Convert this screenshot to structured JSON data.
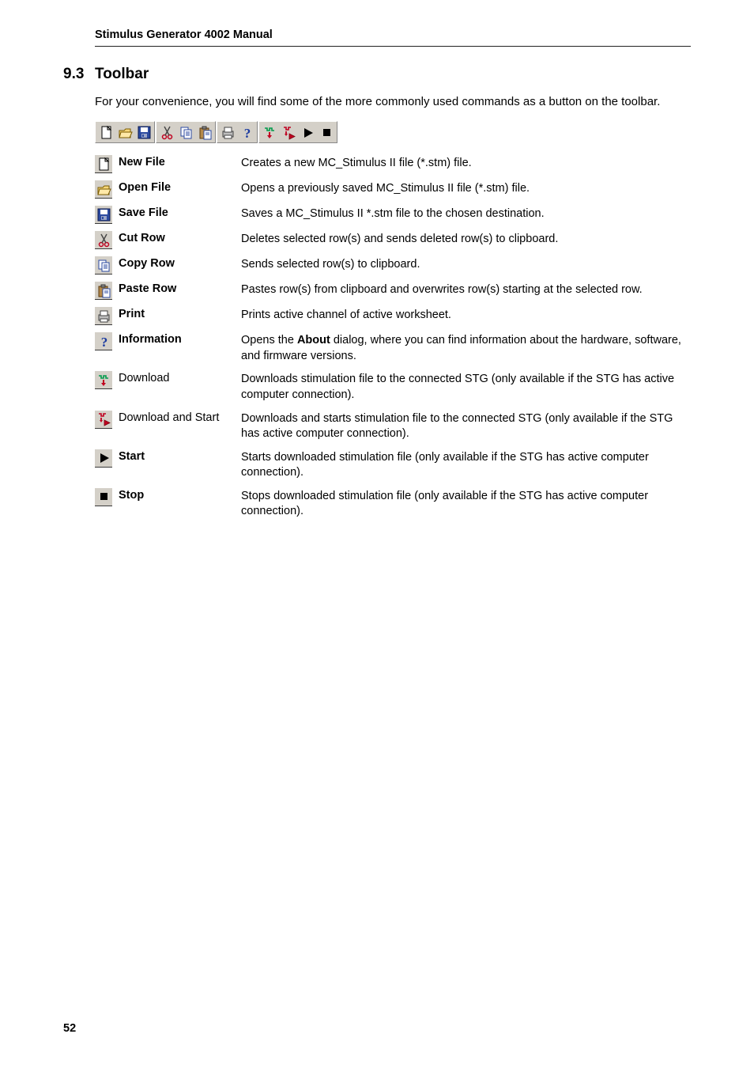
{
  "running_head": "Stimulus Generator 4002 Manual",
  "section": {
    "number": "9.3",
    "title": "Toolbar"
  },
  "intro": "For your convenience, you will find some of the more commonly used commands as a button on the toolbar.",
  "toolbar_groups": [
    [
      "new-file-icon",
      "open-file-icon",
      "save-file-icon"
    ],
    [
      "cut-icon",
      "copy-icon",
      "paste-icon"
    ],
    [
      "print-icon",
      "info-icon"
    ],
    [
      "download-icon",
      "download-start-icon",
      "play-icon",
      "stop-icon"
    ]
  ],
  "rows": [
    {
      "icon": "new-file-icon",
      "term": "New File",
      "bold": true,
      "desc": "Creates a new MC_Stimulus II file (*.stm) file."
    },
    {
      "icon": "open-file-icon",
      "term": "Open File",
      "bold": true,
      "desc": "Opens a previously saved MC_Stimulus II file (*.stm) file."
    },
    {
      "icon": "save-file-icon",
      "term": "Save File",
      "bold": true,
      "desc": "Saves a MC_Stimulus II *.stm file to the chosen destination."
    },
    {
      "icon": "cut-icon",
      "term": "Cut Row",
      "bold": true,
      "desc": "Deletes selected row(s) and sends deleted row(s) to clipboard."
    },
    {
      "icon": "copy-icon",
      "term": "Copy Row",
      "bold": true,
      "desc": "Sends selected row(s) to clipboard."
    },
    {
      "icon": "paste-icon",
      "term": "Paste Row",
      "bold": true,
      "desc": "Pastes row(s) from clipboard and overwrites row(s) starting at the selected row."
    },
    {
      "icon": "print-icon",
      "term": "Print",
      "bold": true,
      "desc": "Prints active channel of active worksheet."
    },
    {
      "icon": "info-icon",
      "term": "Information",
      "bold": true,
      "desc_html": "Opens the <b>About</b> dialog, where you can find information about the hardware, software, and firmware versions."
    },
    {
      "icon": "download-icon",
      "term": "Download",
      "bold": false,
      "desc": "Downloads stimulation file to the connected STG (only available if the STG has active computer connection)."
    },
    {
      "icon": "download-start-icon",
      "term": "Download and Start",
      "bold": false,
      "desc": "Downloads and starts stimulation file to the connected STG (only available if the STG has active computer connection)."
    },
    {
      "icon": "play-icon",
      "term": "Start",
      "bold": true,
      "desc": "Starts downloaded stimulation file (only available if the STG has active computer connection)."
    },
    {
      "icon": "stop-icon",
      "term": "Stop",
      "bold": true,
      "desc": "Stops downloaded stimulation file (only available if the STG has active computer connection)."
    }
  ],
  "page_number": "52"
}
